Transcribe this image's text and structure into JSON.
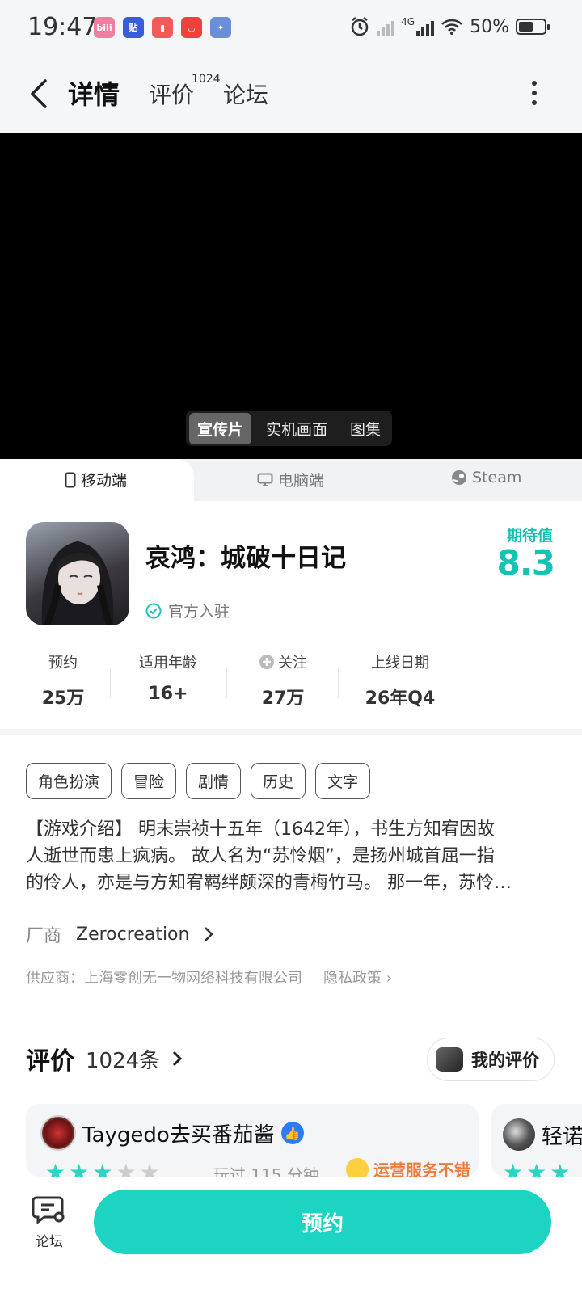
{
  "status_bar": {
    "time": "19:47",
    "app_icons": [
      {
        "name": "bilibili-icon",
        "label": "bili",
        "color": "#f07ea1"
      },
      {
        "name": "tieba-icon",
        "label": "贴",
        "color": "#3b5bdb"
      },
      {
        "name": "reader-icon",
        "label": "",
        "color": "#f25a5a"
      },
      {
        "name": "shop-icon",
        "label": "",
        "color": "#f0423a"
      },
      {
        "name": "game-app-icon",
        "label": "",
        "color": "#6a8fd8"
      }
    ],
    "network": "4G",
    "battery": "50%"
  },
  "nav": {
    "tabs": [
      {
        "label": "详情",
        "active": true
      },
      {
        "label": "评价",
        "active": false
      },
      {
        "label": "论坛",
        "active": false
      }
    ],
    "review_badge": "1024"
  },
  "media": {
    "tabs": [
      {
        "label": "宣传片",
        "active": true
      },
      {
        "label": "实机画面",
        "active": false
      },
      {
        "label": "图集",
        "active": false
      }
    ]
  },
  "platforms": [
    {
      "label": "移动端",
      "active": true,
      "icon": "phone-icon"
    },
    {
      "label": "电脑端",
      "active": false,
      "icon": "monitor-icon"
    },
    {
      "label": "Steam",
      "active": false,
      "icon": "steam-icon"
    }
  ],
  "game": {
    "title": "哀鸿：城破十日记",
    "official_label": "官方入驻",
    "score_label": "期待值",
    "score": "8.3"
  },
  "stats": [
    {
      "label": "预约",
      "value": "25万"
    },
    {
      "label": "适用年龄",
      "value": "16+"
    },
    {
      "label": "关注",
      "value": "27万"
    },
    {
      "label": "上线日期",
      "value": "26年Q4"
    }
  ],
  "tags": [
    "角色扮演",
    "冒险",
    "剧情",
    "历史",
    "文字"
  ],
  "intro": {
    "lines": [
      "【游戏介绍】 明末崇祯十五年（1642年），书生方知宥因故",
      "人逝世而患上疯病。 故人名为“苏怜烟”，是扬州城首屈一指",
      "的伶人，亦是与方知宥羁绊颇深的青梅竹马。 那一年，苏怜…"
    ]
  },
  "maker": {
    "key": "厂商",
    "value": "Zerocreation"
  },
  "supplier": {
    "text": "供应商：上海零创无一物网络科技有限公司",
    "privacy": "隐私政策"
  },
  "reviews": {
    "title": "评价",
    "count": "1024条",
    "my_review_label": "我的评价",
    "cards": [
      {
        "user": "Taygedo去买番茄酱",
        "stars": 3,
        "played": "玩过 115 分钟",
        "tag": "运营服务不错"
      },
      {
        "user": "轻诺",
        "stars": 3
      }
    ]
  },
  "bottom": {
    "forum_label": "论坛",
    "reserve_label": "预约"
  },
  "colors": {
    "accent": "#1dd3c2",
    "score": "#16c2b3",
    "tag_orange": "#ef7a3a"
  }
}
